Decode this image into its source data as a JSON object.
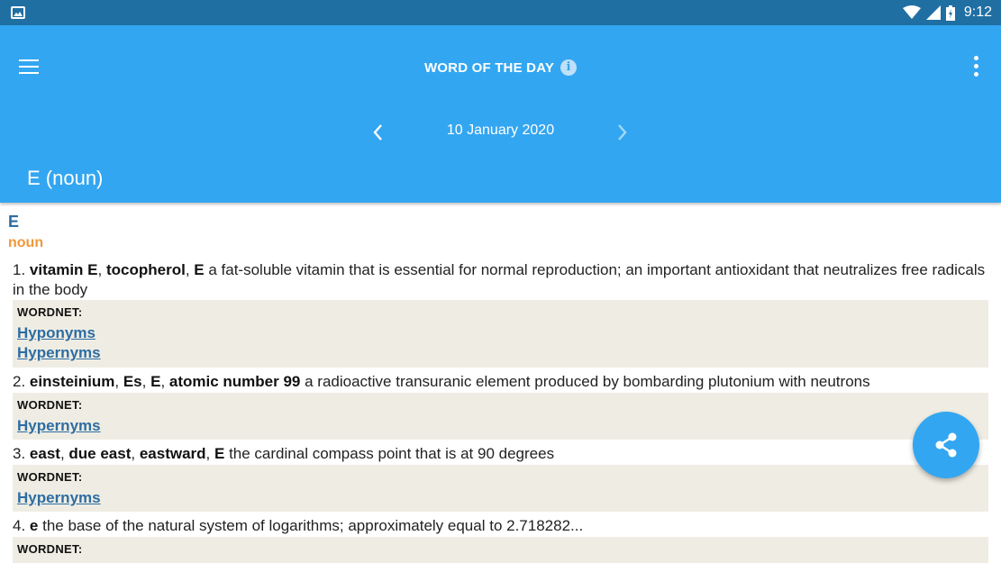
{
  "status_bar": {
    "time": "9:12",
    "icons": [
      "image-icon",
      "wifi-icon",
      "signal-icon",
      "battery-icon"
    ]
  },
  "app_bar": {
    "title": "WORD OF THE DAY",
    "info_icon": "i",
    "date": "10 January 2020",
    "word_heading": "E (noun)"
  },
  "entry": {
    "word": "E",
    "part_of_speech": "noun",
    "senses": [
      {
        "number": "1.",
        "terms": [
          "vitamin E",
          "tocopherol",
          "E"
        ],
        "definition": "a fat-soluble vitamin that is essential for normal reproduction; an important antioxidant that neutralizes free radicals in the body",
        "wordnet_label": "WORDNET:",
        "links": [
          "Hyponyms",
          "Hypernyms"
        ]
      },
      {
        "number": "2.",
        "terms": [
          "einsteinium",
          "Es",
          "E",
          "atomic number 99"
        ],
        "definition": "a radioactive transuranic element produced by bombarding plutonium with neutrons",
        "wordnet_label": "WORDNET:",
        "links": [
          "Hypernyms"
        ]
      },
      {
        "number": "3.",
        "terms": [
          "east",
          "due east",
          "eastward",
          "E"
        ],
        "definition": "the cardinal compass point that is at 90 degrees",
        "wordnet_label": "WORDNET:",
        "links": [
          "Hypernyms"
        ]
      },
      {
        "number": "4.",
        "terms": [
          "e"
        ],
        "definition": "the base of the natural system of logarithms; approximately equal to 2.718282...",
        "wordnet_label": "WORDNET:",
        "links": []
      }
    ]
  },
  "colors": {
    "status_bar": "#1f6fa3",
    "app_bar": "#33a6f1",
    "word": "#2d6da3",
    "part_of_speech": "#f0983a",
    "wordnet_box": "#efede3"
  }
}
